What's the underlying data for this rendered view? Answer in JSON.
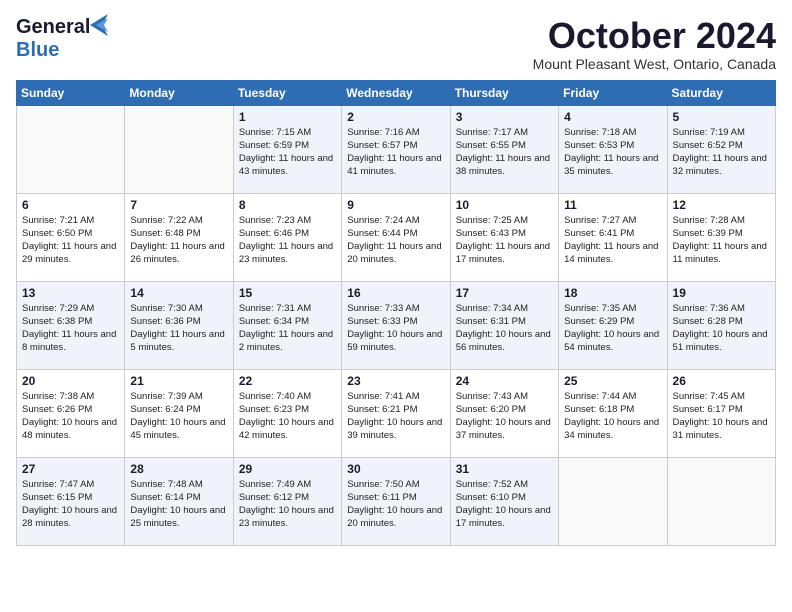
{
  "header": {
    "logo_line1": "General",
    "logo_line2": "Blue",
    "month": "October 2024",
    "location": "Mount Pleasant West, Ontario, Canada"
  },
  "days_of_week": [
    "Sunday",
    "Monday",
    "Tuesday",
    "Wednesday",
    "Thursday",
    "Friday",
    "Saturday"
  ],
  "weeks": [
    [
      {
        "day": "",
        "sunrise": "",
        "sunset": "",
        "daylight": ""
      },
      {
        "day": "",
        "sunrise": "",
        "sunset": "",
        "daylight": ""
      },
      {
        "day": "1",
        "sunrise": "Sunrise: 7:15 AM",
        "sunset": "Sunset: 6:59 PM",
        "daylight": "Daylight: 11 hours and 43 minutes."
      },
      {
        "day": "2",
        "sunrise": "Sunrise: 7:16 AM",
        "sunset": "Sunset: 6:57 PM",
        "daylight": "Daylight: 11 hours and 41 minutes."
      },
      {
        "day": "3",
        "sunrise": "Sunrise: 7:17 AM",
        "sunset": "Sunset: 6:55 PM",
        "daylight": "Daylight: 11 hours and 38 minutes."
      },
      {
        "day": "4",
        "sunrise": "Sunrise: 7:18 AM",
        "sunset": "Sunset: 6:53 PM",
        "daylight": "Daylight: 11 hours and 35 minutes."
      },
      {
        "day": "5",
        "sunrise": "Sunrise: 7:19 AM",
        "sunset": "Sunset: 6:52 PM",
        "daylight": "Daylight: 11 hours and 32 minutes."
      }
    ],
    [
      {
        "day": "6",
        "sunrise": "Sunrise: 7:21 AM",
        "sunset": "Sunset: 6:50 PM",
        "daylight": "Daylight: 11 hours and 29 minutes."
      },
      {
        "day": "7",
        "sunrise": "Sunrise: 7:22 AM",
        "sunset": "Sunset: 6:48 PM",
        "daylight": "Daylight: 11 hours and 26 minutes."
      },
      {
        "day": "8",
        "sunrise": "Sunrise: 7:23 AM",
        "sunset": "Sunset: 6:46 PM",
        "daylight": "Daylight: 11 hours and 23 minutes."
      },
      {
        "day": "9",
        "sunrise": "Sunrise: 7:24 AM",
        "sunset": "Sunset: 6:44 PM",
        "daylight": "Daylight: 11 hours and 20 minutes."
      },
      {
        "day": "10",
        "sunrise": "Sunrise: 7:25 AM",
        "sunset": "Sunset: 6:43 PM",
        "daylight": "Daylight: 11 hours and 17 minutes."
      },
      {
        "day": "11",
        "sunrise": "Sunrise: 7:27 AM",
        "sunset": "Sunset: 6:41 PM",
        "daylight": "Daylight: 11 hours and 14 minutes."
      },
      {
        "day": "12",
        "sunrise": "Sunrise: 7:28 AM",
        "sunset": "Sunset: 6:39 PM",
        "daylight": "Daylight: 11 hours and 11 minutes."
      }
    ],
    [
      {
        "day": "13",
        "sunrise": "Sunrise: 7:29 AM",
        "sunset": "Sunset: 6:38 PM",
        "daylight": "Daylight: 11 hours and 8 minutes."
      },
      {
        "day": "14",
        "sunrise": "Sunrise: 7:30 AM",
        "sunset": "Sunset: 6:36 PM",
        "daylight": "Daylight: 11 hours and 5 minutes."
      },
      {
        "day": "15",
        "sunrise": "Sunrise: 7:31 AM",
        "sunset": "Sunset: 6:34 PM",
        "daylight": "Daylight: 11 hours and 2 minutes."
      },
      {
        "day": "16",
        "sunrise": "Sunrise: 7:33 AM",
        "sunset": "Sunset: 6:33 PM",
        "daylight": "Daylight: 10 hours and 59 minutes."
      },
      {
        "day": "17",
        "sunrise": "Sunrise: 7:34 AM",
        "sunset": "Sunset: 6:31 PM",
        "daylight": "Daylight: 10 hours and 56 minutes."
      },
      {
        "day": "18",
        "sunrise": "Sunrise: 7:35 AM",
        "sunset": "Sunset: 6:29 PM",
        "daylight": "Daylight: 10 hours and 54 minutes."
      },
      {
        "day": "19",
        "sunrise": "Sunrise: 7:36 AM",
        "sunset": "Sunset: 6:28 PM",
        "daylight": "Daylight: 10 hours and 51 minutes."
      }
    ],
    [
      {
        "day": "20",
        "sunrise": "Sunrise: 7:38 AM",
        "sunset": "Sunset: 6:26 PM",
        "daylight": "Daylight: 10 hours and 48 minutes."
      },
      {
        "day": "21",
        "sunrise": "Sunrise: 7:39 AM",
        "sunset": "Sunset: 6:24 PM",
        "daylight": "Daylight: 10 hours and 45 minutes."
      },
      {
        "day": "22",
        "sunrise": "Sunrise: 7:40 AM",
        "sunset": "Sunset: 6:23 PM",
        "daylight": "Daylight: 10 hours and 42 minutes."
      },
      {
        "day": "23",
        "sunrise": "Sunrise: 7:41 AM",
        "sunset": "Sunset: 6:21 PM",
        "daylight": "Daylight: 10 hours and 39 minutes."
      },
      {
        "day": "24",
        "sunrise": "Sunrise: 7:43 AM",
        "sunset": "Sunset: 6:20 PM",
        "daylight": "Daylight: 10 hours and 37 minutes."
      },
      {
        "day": "25",
        "sunrise": "Sunrise: 7:44 AM",
        "sunset": "Sunset: 6:18 PM",
        "daylight": "Daylight: 10 hours and 34 minutes."
      },
      {
        "day": "26",
        "sunrise": "Sunrise: 7:45 AM",
        "sunset": "Sunset: 6:17 PM",
        "daylight": "Daylight: 10 hours and 31 minutes."
      }
    ],
    [
      {
        "day": "27",
        "sunrise": "Sunrise: 7:47 AM",
        "sunset": "Sunset: 6:15 PM",
        "daylight": "Daylight: 10 hours and 28 minutes."
      },
      {
        "day": "28",
        "sunrise": "Sunrise: 7:48 AM",
        "sunset": "Sunset: 6:14 PM",
        "daylight": "Daylight: 10 hours and 25 minutes."
      },
      {
        "day": "29",
        "sunrise": "Sunrise: 7:49 AM",
        "sunset": "Sunset: 6:12 PM",
        "daylight": "Daylight: 10 hours and 23 minutes."
      },
      {
        "day": "30",
        "sunrise": "Sunrise: 7:50 AM",
        "sunset": "Sunset: 6:11 PM",
        "daylight": "Daylight: 10 hours and 20 minutes."
      },
      {
        "day": "31",
        "sunrise": "Sunrise: 7:52 AM",
        "sunset": "Sunset: 6:10 PM",
        "daylight": "Daylight: 10 hours and 17 minutes."
      },
      {
        "day": "",
        "sunrise": "",
        "sunset": "",
        "daylight": ""
      },
      {
        "day": "",
        "sunrise": "",
        "sunset": "",
        "daylight": ""
      }
    ]
  ]
}
